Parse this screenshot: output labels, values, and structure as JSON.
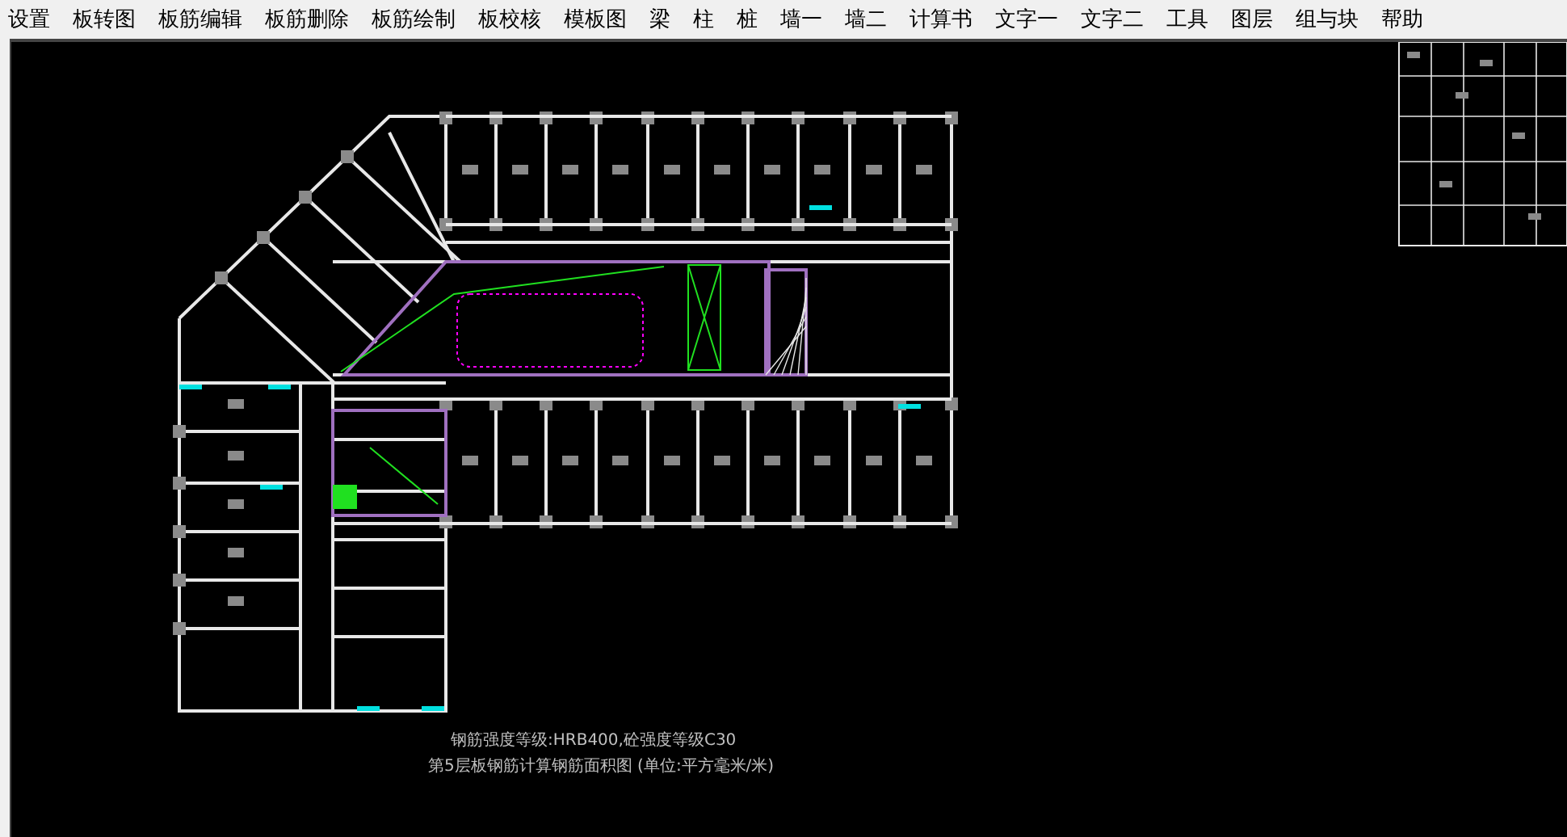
{
  "menu_bar": {
    "items": [
      {
        "label": "设置"
      },
      {
        "label": "板转图"
      },
      {
        "label": "板筋编辑"
      },
      {
        "label": "板筋删除"
      },
      {
        "label": "板筋绘制"
      },
      {
        "label": "板校核"
      },
      {
        "label": "模板图"
      },
      {
        "label": "梁"
      },
      {
        "label": "柱"
      },
      {
        "label": "桩"
      },
      {
        "label": "墙一"
      },
      {
        "label": "墙二"
      },
      {
        "label": "计算书"
      },
      {
        "label": "文字一"
      },
      {
        "label": "文字二"
      },
      {
        "label": "工具"
      },
      {
        "label": "图层"
      },
      {
        "label": "组与块"
      },
      {
        "label": "帮助"
      }
    ]
  },
  "drawing": {
    "captions": [
      "钢筋强度等级:HRB400,砼强度等级C30",
      "第5层板钢筋计算钢筋面积图 (单位:平方毫米/米)"
    ]
  }
}
